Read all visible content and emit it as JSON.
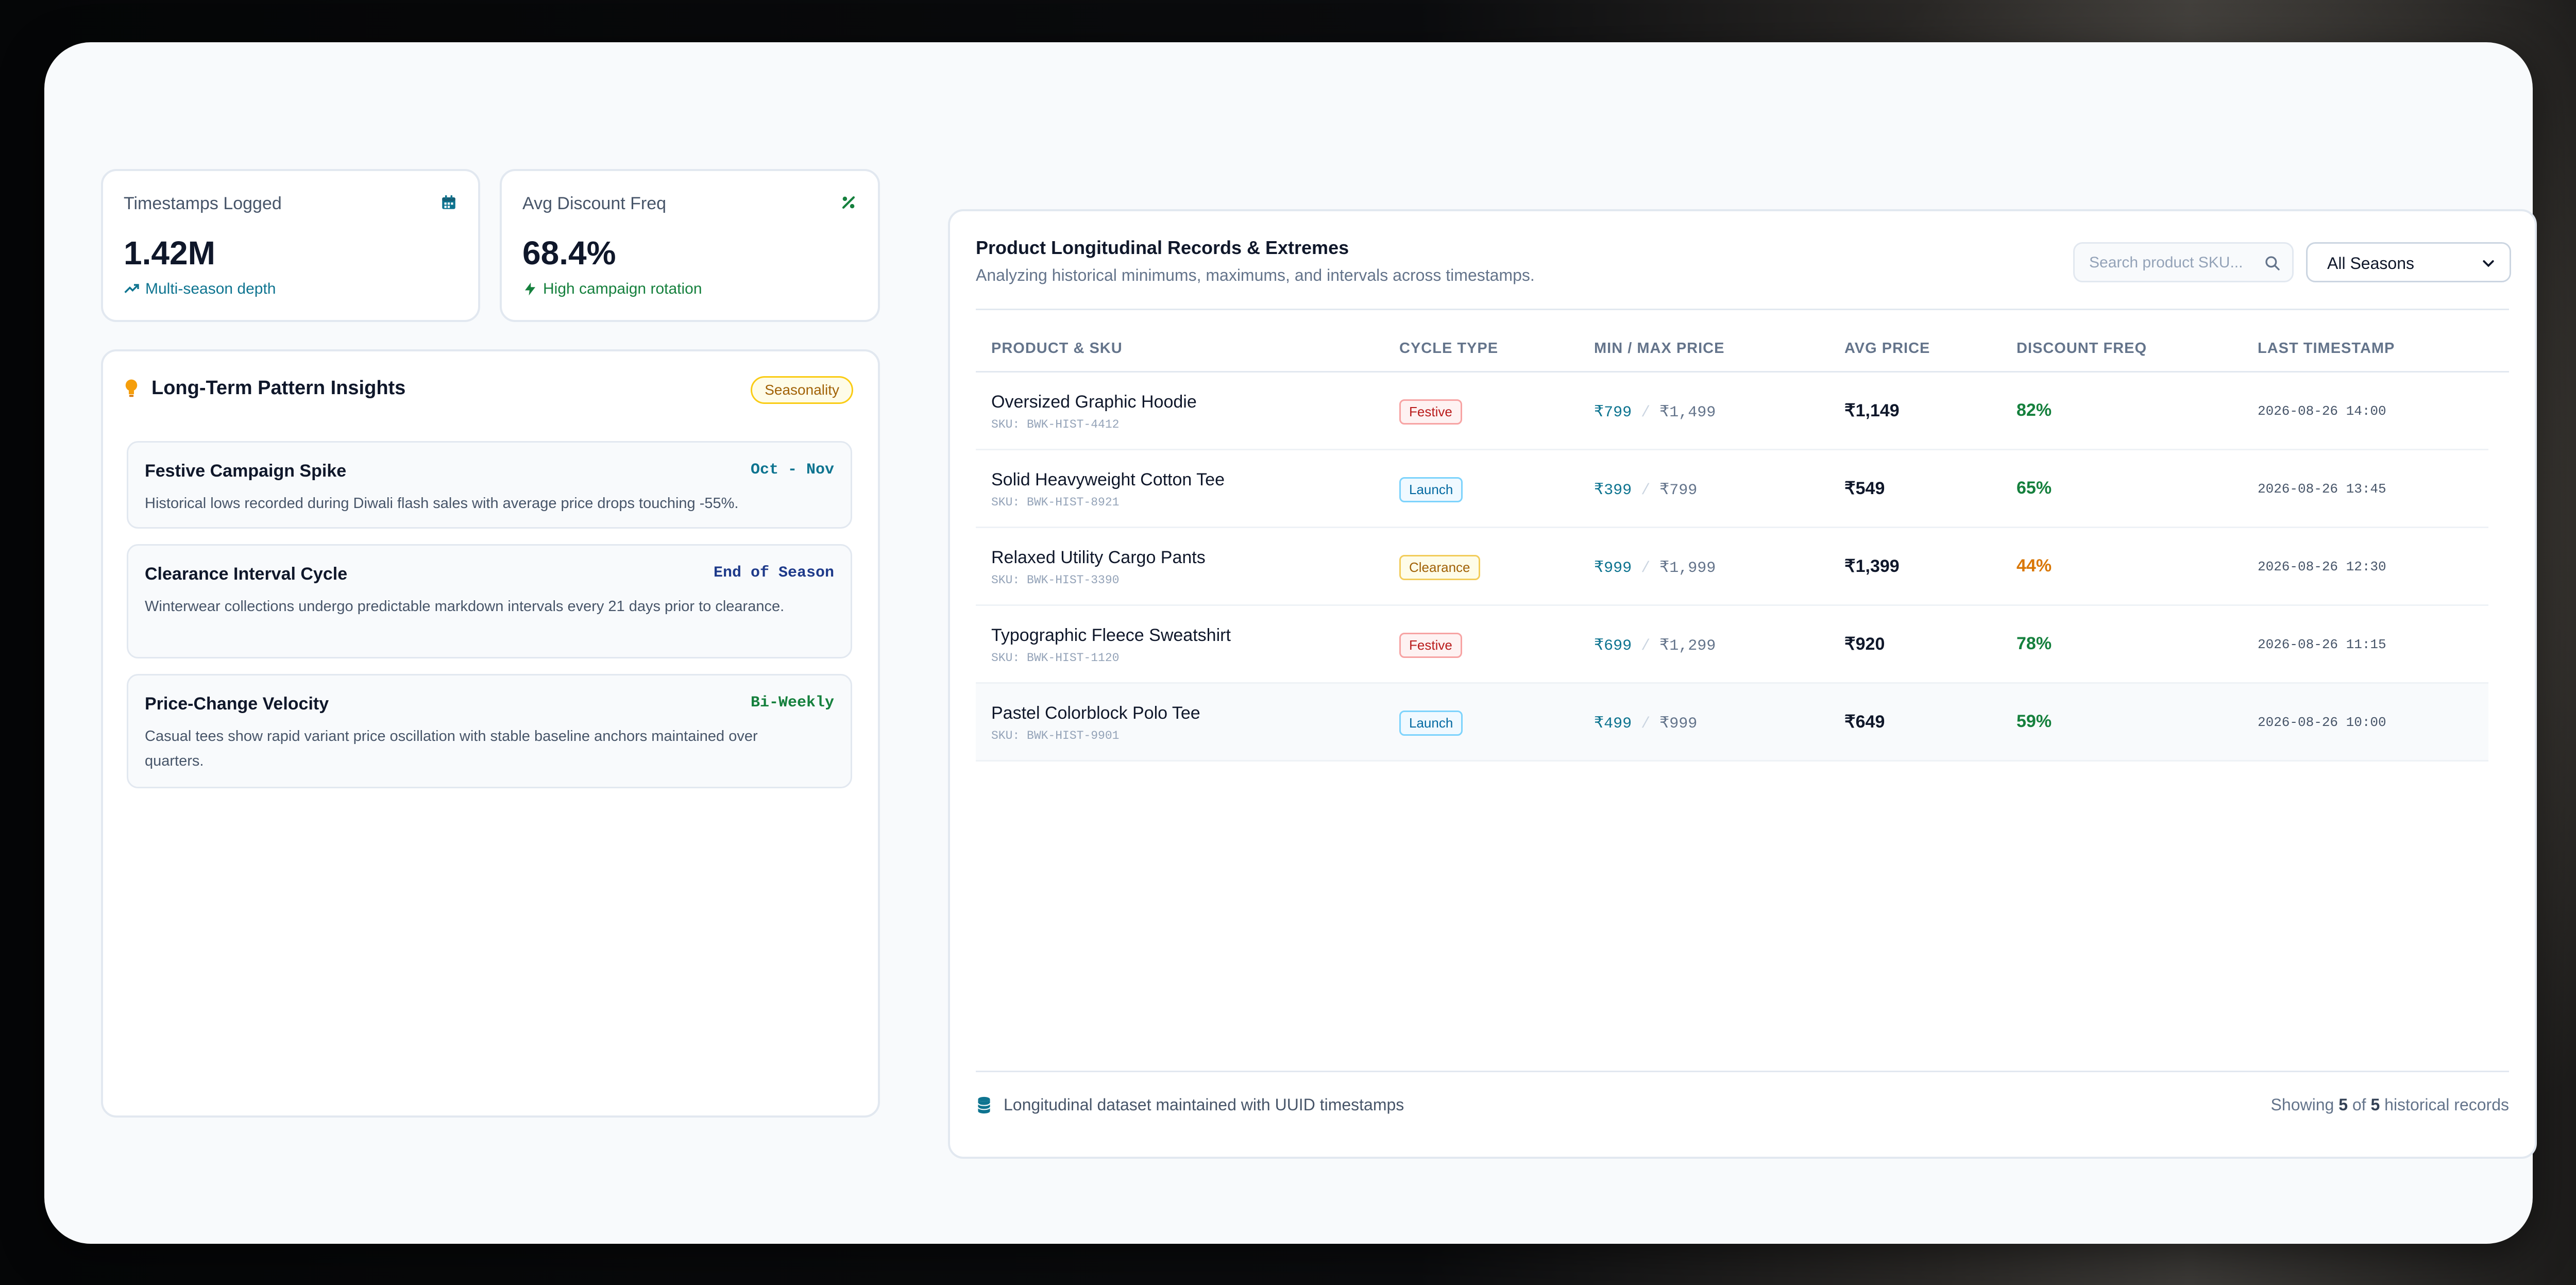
{
  "kpis": [
    {
      "label": "Timestamps Logged",
      "value": "1.42M",
      "sub": "Multi-season depth",
      "icon": "calendar-icon"
    },
    {
      "label": "Avg Discount Freq",
      "value": "68.4%",
      "sub": "High campaign rotation",
      "icon": "percent-icon"
    }
  ],
  "insights": {
    "title": "Long-Term Pattern Insights",
    "badge": "Seasonality",
    "items": [
      {
        "title": "Festive Campaign Spike",
        "tag": "Oct - Nov",
        "desc": "Historical lows recorded during Diwali flash sales with average price drops touching -55%."
      },
      {
        "title": "Clearance Interval Cycle",
        "tag": "End of Season",
        "desc": "Winterwear collections undergo predictable markdown intervals every 21 days prior to clearance."
      },
      {
        "title": "Price-Change Velocity",
        "tag": "Bi-Weekly",
        "desc": "Casual tees show rapid variant price oscillation with stable baseline anchors maintained over quarters."
      }
    ]
  },
  "records": {
    "title": "Product Longitudinal Records & Extremes",
    "subtitle": "Analyzing historical minimums, maximums, and intervals across timestamps.",
    "search_placeholder": "Search product SKU...",
    "season_select": "All Seasons",
    "columns": [
      "PRODUCT & SKU",
      "CYCLE TYPE",
      "MIN / MAX PRICE",
      "AVG PRICE",
      "DISCOUNT FREQ",
      "LAST TIMESTAMP"
    ],
    "rows": [
      {
        "name": "Oversized Graphic Hoodie",
        "sku": "SKU: BWK-HIST-4412",
        "cycle": "Festive",
        "min": "₹799",
        "max": "₹1,499",
        "avg": "₹1,149",
        "freq": "82%",
        "ts": "2026-08-26 14:00"
      },
      {
        "name": "Solid Heavyweight Cotton Tee",
        "sku": "SKU: BWK-HIST-8921",
        "cycle": "Launch",
        "min": "₹399",
        "max": "₹799",
        "avg": "₹549",
        "freq": "65%",
        "ts": "2026-08-26 13:45"
      },
      {
        "name": "Relaxed Utility Cargo Pants",
        "sku": "SKU: BWK-HIST-3390",
        "cycle": "Clearance",
        "min": "₹999",
        "max": "₹1,999",
        "avg": "₹1,399",
        "freq": "44%",
        "ts": "2026-08-26 12:30"
      },
      {
        "name": "Typographic Fleece Sweatshirt",
        "sku": "SKU: BWK-HIST-1120",
        "cycle": "Festive",
        "min": "₹699",
        "max": "₹1,299",
        "avg": "₹920",
        "freq": "78%",
        "ts": "2026-08-26 11:15"
      },
      {
        "name": "Pastel Colorblock Polo Tee",
        "sku": "SKU: BWK-HIST-9901",
        "cycle": "Launch",
        "min": "₹499",
        "max": "₹999",
        "avg": "₹649",
        "freq": "59%",
        "ts": "2026-08-26 10:00"
      }
    ],
    "footer_note": "Longitudinal dataset maintained with UUID timestamps",
    "footer_showing": "Showing",
    "footer_count": "5",
    "footer_of": "of",
    "footer_total": "5",
    "footer_suffix": "historical records"
  },
  "colors": {
    "accent": "#0e7490",
    "positive": "#15803d",
    "warning": "#d97706"
  }
}
